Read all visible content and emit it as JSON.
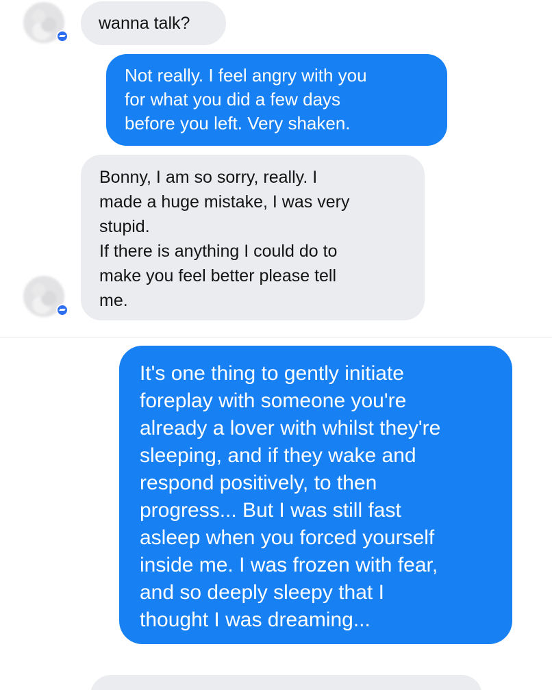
{
  "messages": [
    {
      "side": "in",
      "text": "wanna talk?"
    },
    {
      "side": "out",
      "text": "Not really.  I feel angry with you\nfor what you did a few days\nbefore you left.  Very shaken."
    },
    {
      "side": "in",
      "text": "Bonny, I am so sorry, really. I\nmade a huge mistake, I was very\nstupid.\nIf there is anything I could do to\nmake you feel better please tell\nme."
    },
    {
      "side": "out",
      "text": "It's one thing to gently initiate\nforeplay with someone you're\nalready a lover with whilst they're\nsleeping, and if they wake and\nrespond positively, to then\nprogress... But I was still fast\nasleep when you forced yourself\ninside me.  I was frozen with fear,\nand so deeply sleepy that I\nthought I was dreaming..."
    }
  ],
  "avatars": [
    {
      "icon": "blurred-contact-avatar",
      "status_icon": "messenger-badge-icon"
    },
    {
      "icon": "blurred-contact-avatar",
      "status_icon": "messenger-badge-icon"
    }
  ],
  "colors": {
    "outgoing_bubble": "#1780f2",
    "incoming_bubble": "#ebecef",
    "badge": "#2d6df0"
  }
}
